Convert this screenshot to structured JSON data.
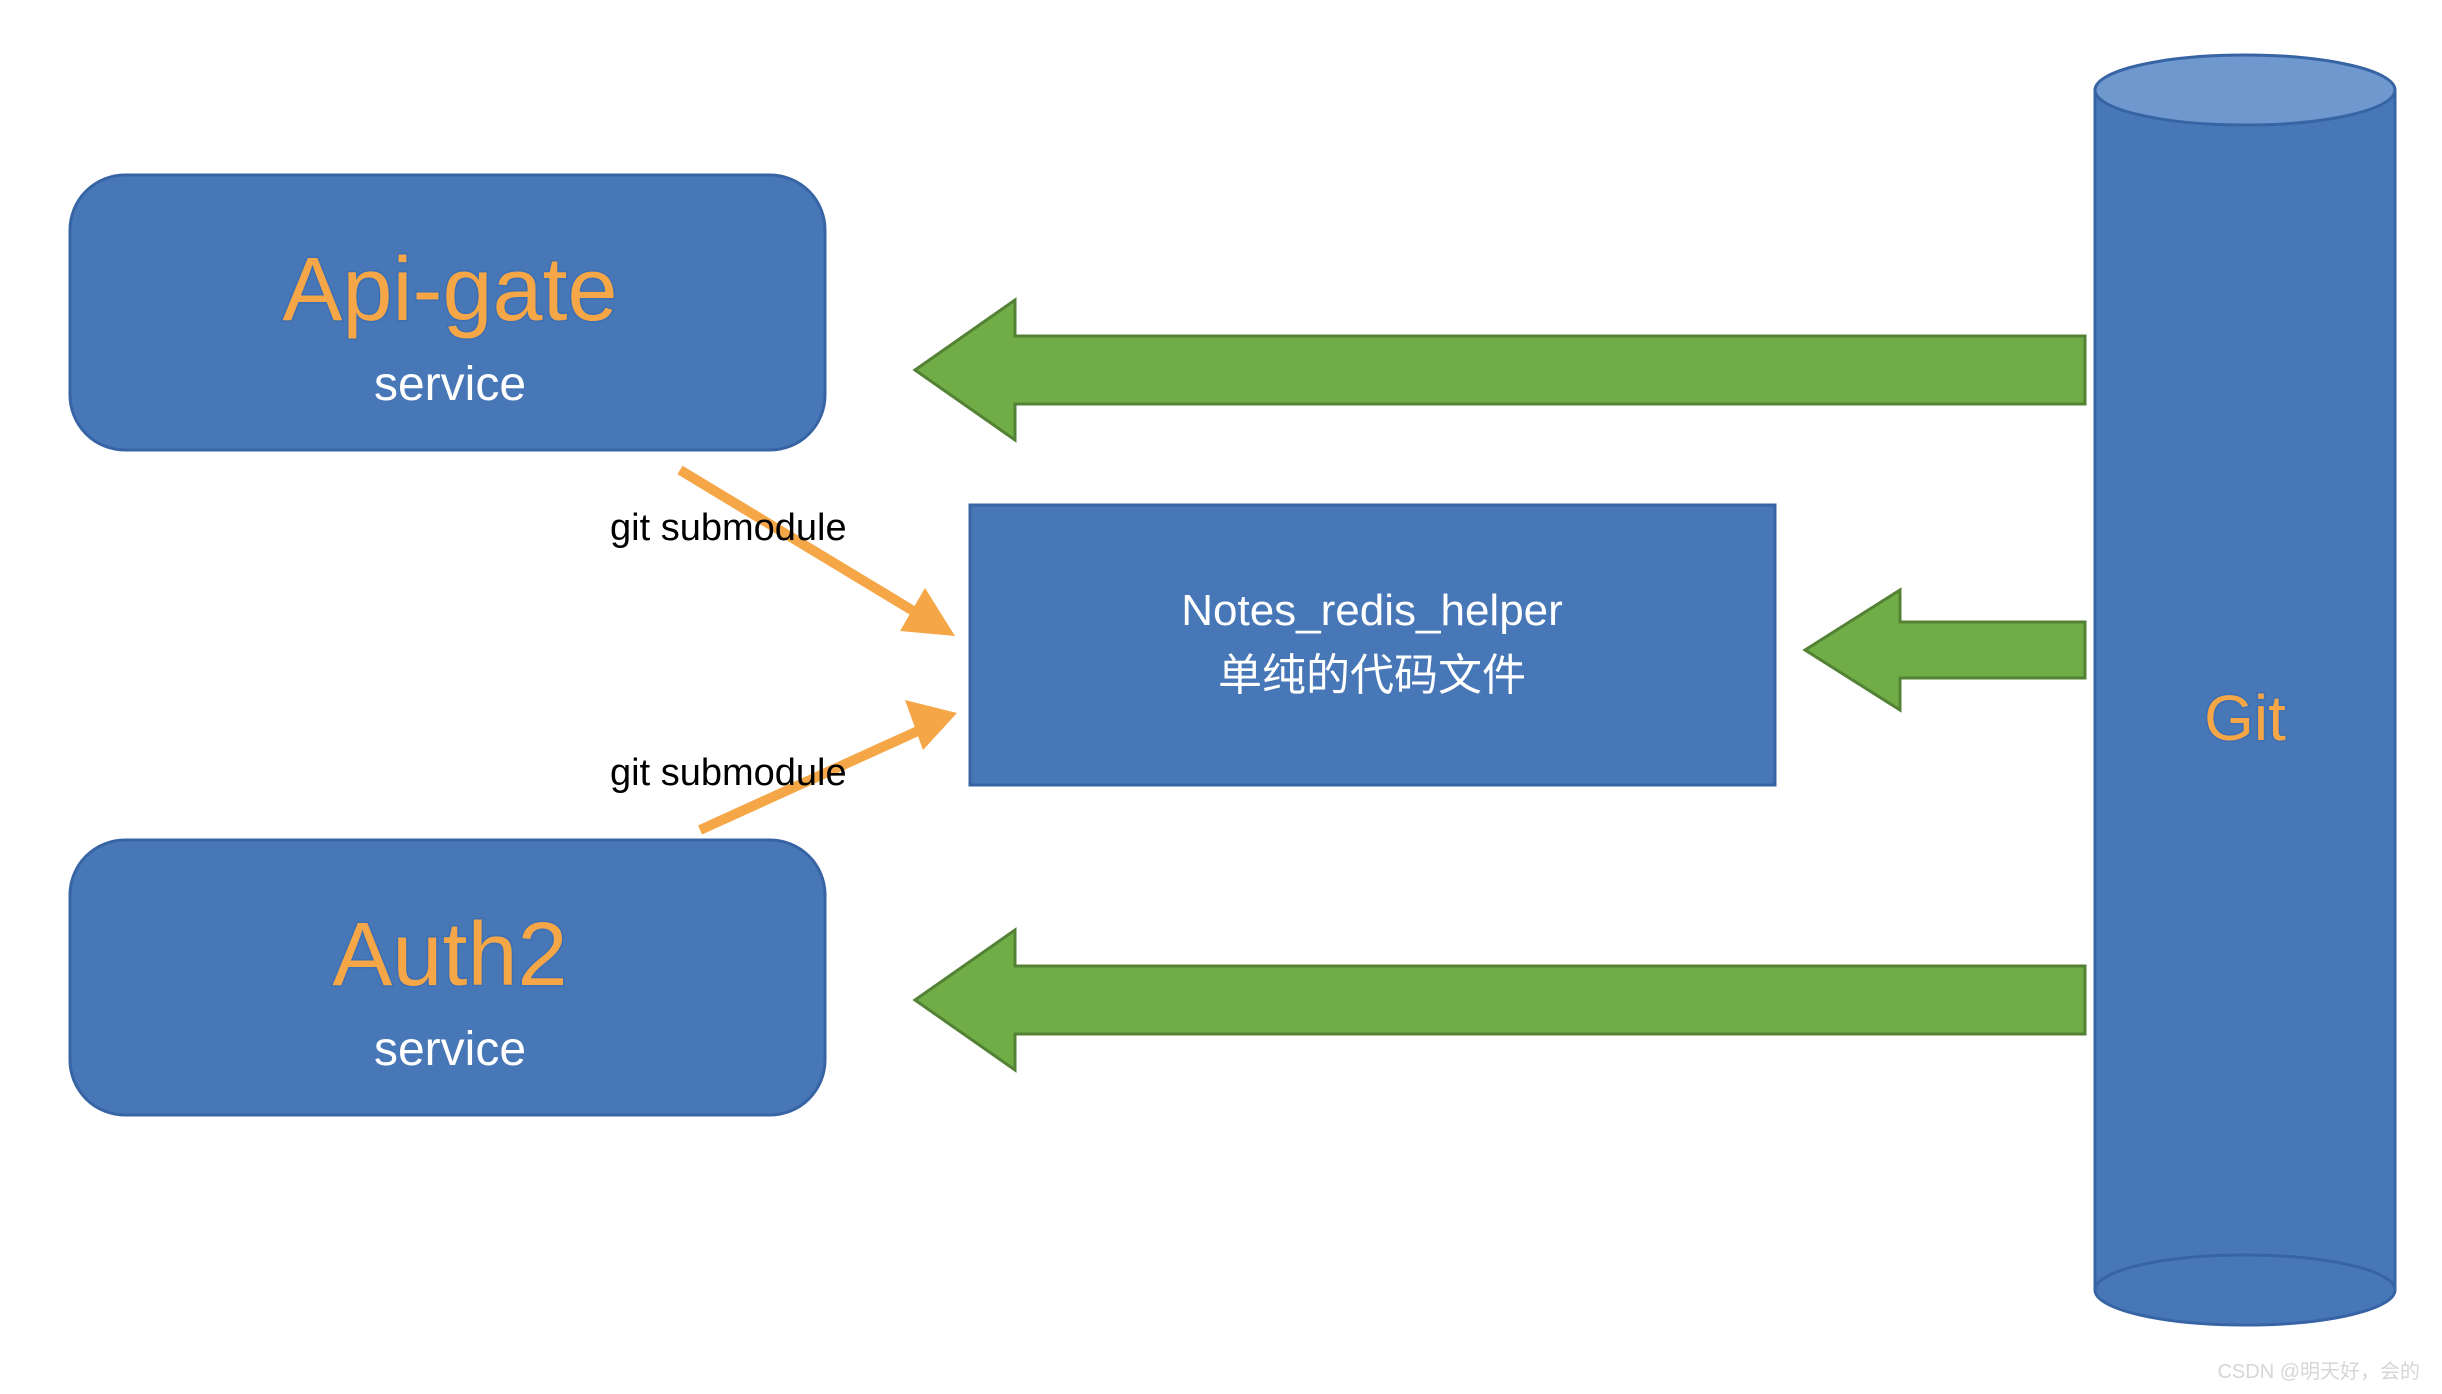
{
  "colors": {
    "box_fill": "#4877b7",
    "box_stroke": "#3764a4",
    "cyl_top": "#6e98ce",
    "arrow_green_fill": "#70ad47",
    "arrow_green_stroke": "#548235",
    "arrow_orange": "#f5a646",
    "title_fill": "#f5a646",
    "title_stroke": "#3c6fb3"
  },
  "nodes": {
    "api_gate": {
      "title": "Api-gate",
      "subtitle": "service"
    },
    "auth2": {
      "title": "Auth2",
      "subtitle": "service"
    },
    "helper": {
      "line1": "Notes_redis_helper",
      "line2": "单纯的代码文件"
    },
    "git": {
      "label": "Git"
    }
  },
  "labels": {
    "submodule1": "git submodule",
    "submodule2": "git submodule"
  },
  "watermark": "CSDN @明天好，会的"
}
